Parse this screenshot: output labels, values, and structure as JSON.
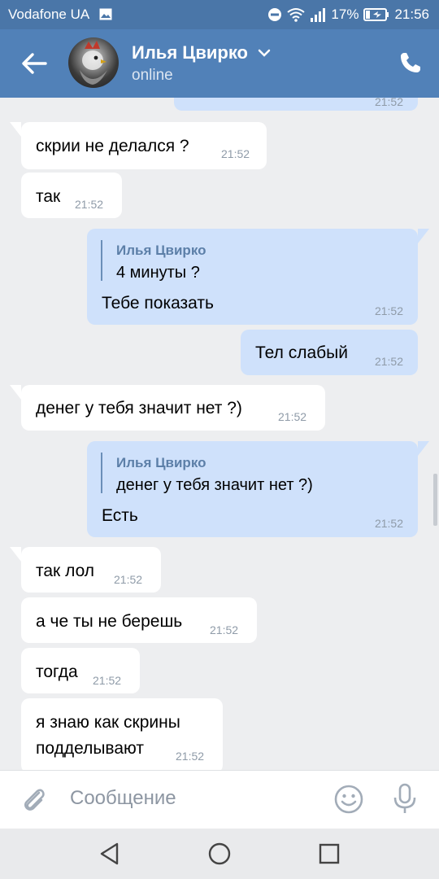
{
  "status_bar": {
    "carrier": "Vodafone UA",
    "battery": "17%",
    "time": "21:56",
    "icons": [
      "image-icon",
      "dnd-icon",
      "wifi-icon",
      "signal-icon",
      "battery-charging-icon"
    ]
  },
  "header": {
    "contact_name": "Илья Цвирко",
    "presence": "online",
    "icons": [
      "back-arrow-icon",
      "chevron-down-icon",
      "phone-icon"
    ]
  },
  "messages": [
    {
      "dir": "out",
      "text": "",
      "time": "21:52",
      "partial": true
    },
    {
      "dir": "in",
      "text": "скрии не делался ?",
      "time": "21:52"
    },
    {
      "dir": "in",
      "text": "так",
      "time": "21:52"
    },
    {
      "dir": "out",
      "reply_name": "Илья Цвирко",
      "reply_text": "4 минуты ?",
      "text": "Тебе показать",
      "time": "21:52"
    },
    {
      "dir": "out",
      "text": "Тел слабый",
      "time": "21:52"
    },
    {
      "dir": "in",
      "text": "денег у тебя значит нет ?)",
      "time": "21:52"
    },
    {
      "dir": "out",
      "reply_name": "Илья Цвирко",
      "reply_text": "денег у тебя значит нет ?)",
      "text": "Есть",
      "time": "21:52"
    },
    {
      "dir": "in",
      "text": "так лол",
      "time": "21:52"
    },
    {
      "dir": "in",
      "text": "а че ты не берешь",
      "time": "21:52"
    },
    {
      "dir": "in",
      "text": "тогда",
      "time": "21:52"
    },
    {
      "dir": "in",
      "text_line1": "я знаю как скрины",
      "text_line2": "подделывают",
      "time": "21:52"
    }
  ],
  "composer": {
    "placeholder": "Сообщение",
    "icons": [
      "attach-icon",
      "emoji-icon",
      "microphone-icon"
    ]
  },
  "nav_bar": {
    "icons": [
      "nav-back-icon",
      "nav-home-icon",
      "nav-recents-icon"
    ]
  },
  "colors": {
    "header": "#5181b8",
    "status_bar": "#4a76a8",
    "chat_bg": "#edeef0",
    "incoming_bubble": "#ffffff",
    "outgoing_bubble": "#cfe1fb",
    "timestamp": "#8f9ba8",
    "reply_name": "#5c7fa8"
  }
}
